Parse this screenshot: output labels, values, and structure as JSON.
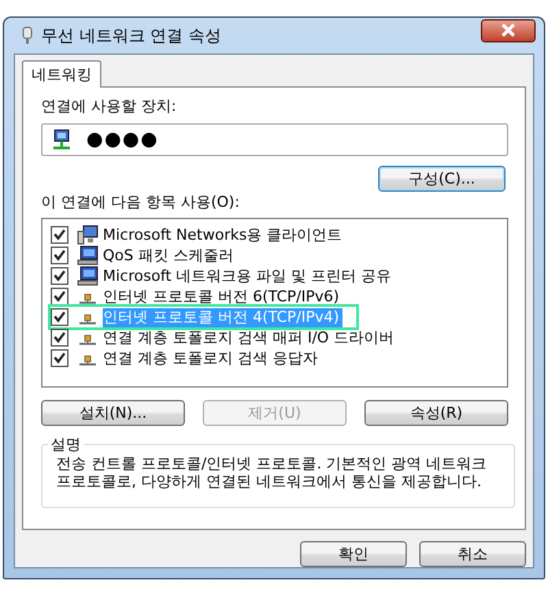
{
  "window": {
    "title": "무선 네트워크 연결 속성"
  },
  "tabs": [
    {
      "label": "네트워킹",
      "selected": true
    }
  ],
  "device": {
    "label": "연결에 사용할 장치:",
    "value": "●●●●",
    "button": "구성(C)..."
  },
  "items_label": "이 연결에 다음 항목 사용(O):",
  "items": [
    {
      "label": "Microsoft Networks용 클라이언트",
      "kind": "client",
      "checked": true,
      "selected": false
    },
    {
      "label": "QoS 패킷 스케줄러",
      "kind": "service",
      "checked": true,
      "selected": false
    },
    {
      "label": "Microsoft 네트워크용 파일 및 프린터 공유",
      "kind": "service",
      "checked": true,
      "selected": false
    },
    {
      "label": "인터넷 프로토콜 버전 6(TCP/IPv6)",
      "kind": "protocol",
      "checked": true,
      "selected": false
    },
    {
      "label": "인터넷 프로토콜 버전 4(TCP/IPv4)",
      "kind": "protocol",
      "checked": true,
      "selected": true
    },
    {
      "label": "연결 계층 토폴로지 검색 매퍼 I/O 드라이버",
      "kind": "protocol",
      "checked": true,
      "selected": false
    },
    {
      "label": "연결 계층 토폴로지 검색 응답자",
      "kind": "protocol",
      "checked": true,
      "selected": false
    }
  ],
  "item_buttons": [
    {
      "label": "설치(N)...",
      "disabled": false
    },
    {
      "label": "제거(U)",
      "disabled": true
    },
    {
      "label": "속성(R)",
      "disabled": false
    }
  ],
  "description": {
    "title": "설명",
    "text": "전송 컨트롤 프로토콜/인터넷 프로토콜. 기본적인 광역 네트워크 프로토콜로, 다양하게 연결된 네트워크에서 통신을 제공합니다."
  },
  "buttons": [
    "확인",
    "취소"
  ]
}
